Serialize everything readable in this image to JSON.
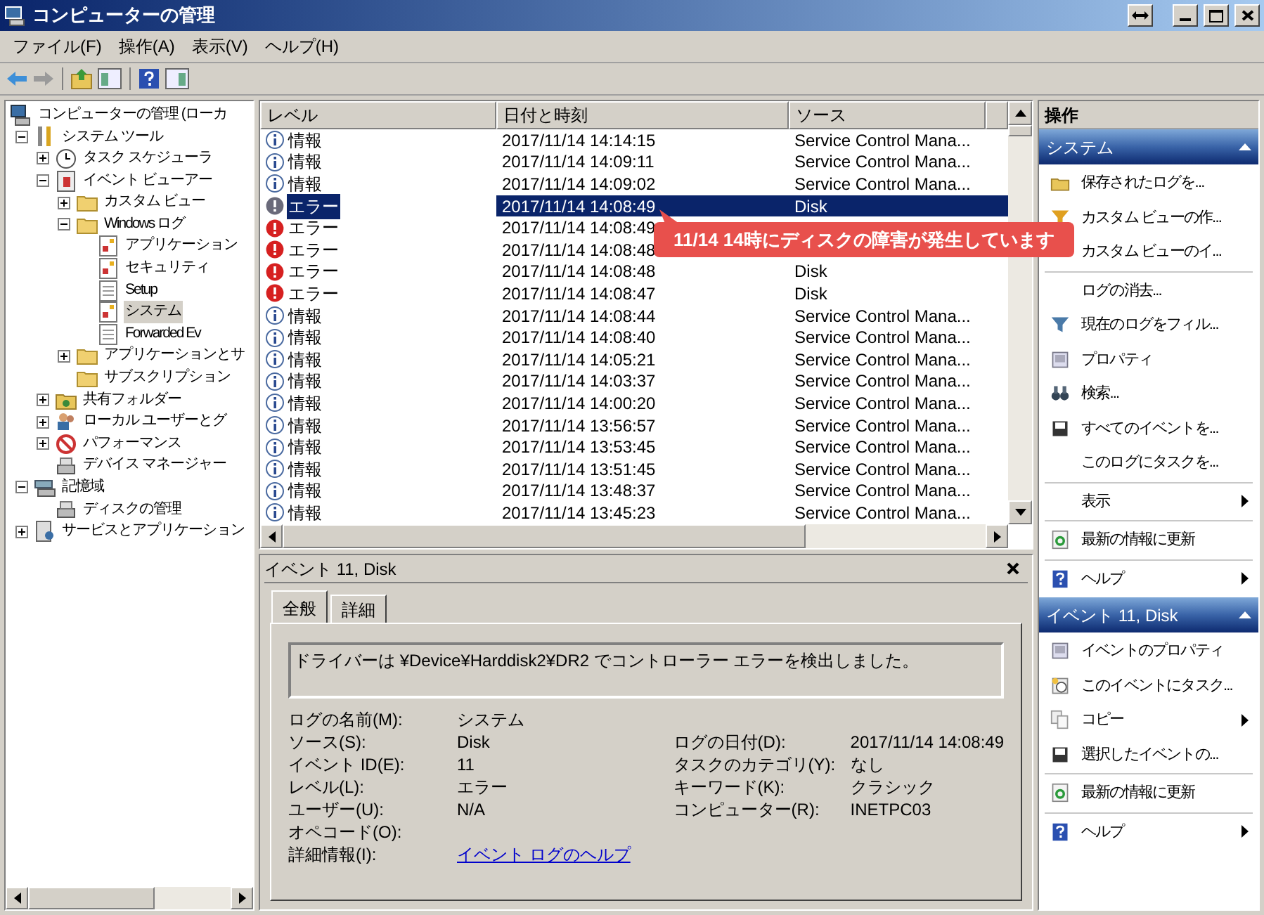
{
  "window": {
    "title": "コンピューターの管理"
  },
  "menu": [
    "ファイル(F)",
    "操作(A)",
    "表示(V)",
    "ヘルプ(H)"
  ],
  "tree": [
    {
      "label": "コンピューターの管理 (ローカ",
      "kind": "computer",
      "selected": false,
      "children": [
        {
          "label": "システム ツール",
          "kind": "tools",
          "expanded": true,
          "selected": false,
          "children": [
            {
              "label": "タスク スケジューラ",
              "kind": "clock",
              "expanded": false,
              "selected": false
            },
            {
              "label": "イベント ビューアー",
              "kind": "viewer",
              "expanded": true,
              "selected": false,
              "children": [
                {
                  "label": "カスタム ビュー",
                  "kind": "folder",
                  "expanded": false,
                  "selected": false
                },
                {
                  "label": "Windows ログ",
                  "kind": "folder",
                  "expanded": true,
                  "selected": false,
                  "children": [
                    {
                      "label": "アプリケーション",
                      "kind": "log",
                      "selected": false
                    },
                    {
                      "label": "セキュリティ",
                      "kind": "log",
                      "selected": false
                    },
                    {
                      "label": "Setup",
                      "kind": "doc",
                      "selected": false
                    },
                    {
                      "label": "システム",
                      "kind": "log",
                      "selected": true
                    },
                    {
                      "label": "Forwarded Ev",
                      "kind": "doc",
                      "selected": false
                    }
                  ]
                },
                {
                  "label": "アプリケーションとサ",
                  "kind": "folder",
                  "expanded": false,
                  "selected": false
                },
                {
                  "label": "サブスクリプション",
                  "kind": "folder",
                  "selected": false
                }
              ]
            },
            {
              "label": "共有フォルダー",
              "kind": "share",
              "expanded": false,
              "selected": false
            },
            {
              "label": "ローカル ユーザーとグ",
              "kind": "users",
              "expanded": false,
              "selected": false
            },
            {
              "label": "パフォーマンス",
              "kind": "perf",
              "expanded": false,
              "selected": false
            },
            {
              "label": "デバイス マネージャー",
              "kind": "device",
              "selected": false
            }
          ]
        },
        {
          "label": "記憶域",
          "kind": "storage",
          "expanded": true,
          "selected": false,
          "children": [
            {
              "label": "ディスクの管理",
              "kind": "device",
              "selected": false
            }
          ]
        },
        {
          "label": "サービスとアプリケーション",
          "kind": "services",
          "expanded": false,
          "selected": false
        }
      ]
    }
  ],
  "events": {
    "columns": [
      "レベル",
      "日付と時刻",
      "ソース"
    ],
    "rows": [
      {
        "kind": "info",
        "level": "情報",
        "datetime": "2017/11/14 14:14:15",
        "source": "Service Control Mana...",
        "selected": false
      },
      {
        "kind": "info",
        "level": "情報",
        "datetime": "2017/11/14 14:09:11",
        "source": "Service Control Mana...",
        "selected": false
      },
      {
        "kind": "info",
        "level": "情報",
        "datetime": "2017/11/14 14:09:02",
        "source": "Service Control Mana...",
        "selected": false
      },
      {
        "kind": "error",
        "level": "エラー",
        "datetime": "2017/11/14 14:08:49",
        "source": "Disk",
        "selected": true
      },
      {
        "kind": "error",
        "level": "エラー",
        "datetime": "2017/11/14 14:08:49",
        "selected": false
      },
      {
        "kind": "error",
        "level": "エラー",
        "datetime": "2017/11/14 14:08:48",
        "selected": false
      },
      {
        "kind": "error",
        "level": "エラー",
        "datetime": "2017/11/14 14:08:48",
        "source": "Disk",
        "selected": false
      },
      {
        "kind": "error",
        "level": "エラー",
        "datetime": "2017/11/14 14:08:47",
        "source": "Disk",
        "selected": false
      },
      {
        "kind": "info",
        "level": "情報",
        "datetime": "2017/11/14 14:08:44",
        "source": "Service Control Mana...",
        "selected": false
      },
      {
        "kind": "info",
        "level": "情報",
        "datetime": "2017/11/14 14:08:40",
        "source": "Service Control Mana...",
        "selected": false
      },
      {
        "kind": "info",
        "level": "情報",
        "datetime": "2017/11/14 14:05:21",
        "source": "Service Control Mana...",
        "selected": false
      },
      {
        "kind": "info",
        "level": "情報",
        "datetime": "2017/11/14 14:03:37",
        "source": "Service Control Mana...",
        "selected": false
      },
      {
        "kind": "info",
        "level": "情報",
        "datetime": "2017/11/14 14:00:20",
        "source": "Service Control Mana...",
        "selected": false
      },
      {
        "kind": "info",
        "level": "情報",
        "datetime": "2017/11/14 13:56:57",
        "source": "Service Control Mana...",
        "selected": false
      },
      {
        "kind": "info",
        "level": "情報",
        "datetime": "2017/11/14 13:53:45",
        "source": "Service Control Mana...",
        "selected": false
      },
      {
        "kind": "info",
        "level": "情報",
        "datetime": "2017/11/14 13:51:45",
        "source": "Service Control Mana...",
        "selected": false
      },
      {
        "kind": "info",
        "level": "情報",
        "datetime": "2017/11/14 13:48:37",
        "source": "Service Control Mana...",
        "selected": false
      },
      {
        "kind": "info",
        "level": "情報",
        "datetime": "2017/11/14 13:45:23",
        "source": "Service Control Mana...",
        "selected": false
      }
    ]
  },
  "callout": {
    "text": "11/14  14時にディスクの障害が発生しています"
  },
  "detail": {
    "title": "イベント 11, Disk",
    "tabs": [
      {
        "label": "全般",
        "selected": true
      },
      {
        "label": "詳細",
        "selected": false
      }
    ],
    "message": "ドライバーは ¥Device¥Harddisk2¥DR2 でコントローラー エラーを検出しました。",
    "fields_left": [
      {
        "label": "ログの名前(M):",
        "value": "システム"
      },
      {
        "label": "ソース(S):",
        "value": "Disk"
      },
      {
        "label": "イベント ID(E):",
        "value": "11"
      },
      {
        "label": "レベル(L):",
        "value": "エラー"
      },
      {
        "label": "ユーザー(U):",
        "value": "N/A"
      },
      {
        "label": "オペコード(O):"
      },
      {
        "label": "詳細情報(I):",
        "value": "イベント ログのヘルプ",
        "kind": "link"
      }
    ],
    "fields_right": [
      {
        "label": "ログの日付(D):",
        "value": "2017/11/14 14:08:49"
      },
      {
        "label": "タスクのカテゴリ(Y):",
        "value": "なし"
      },
      {
        "label": "キーワード(K):",
        "value": "クラシック"
      },
      {
        "label": "コンピューター(R):",
        "value": "INETPC03"
      }
    ]
  },
  "actions": {
    "title": "操作",
    "sections": [
      {
        "title": "システム",
        "groups": [
          [
            {
              "label": "保存されたログを...",
              "kind": "open",
              "submenu": false
            },
            {
              "label": "カスタム ビューの作...",
              "kind": "create-view",
              "submenu": false
            },
            {
              "label": "カスタム ビューのイ...",
              "kind": "plain",
              "submenu": false
            }
          ],
          [
            {
              "label": "ログの消去...",
              "kind": "plain",
              "submenu": false
            },
            {
              "label": "現在のログをフィル...",
              "kind": "filter",
              "submenu": false
            },
            {
              "label": "プロパティ",
              "kind": "properties",
              "submenu": false
            },
            {
              "label": "検索...",
              "kind": "find",
              "submenu": false
            },
            {
              "label": "すべてのイベントを...",
              "kind": "save",
              "submenu": false
            },
            {
              "label": "このログにタスクを...",
              "kind": "plain",
              "submenu": false
            }
          ],
          [
            {
              "label": "表示",
              "kind": "plain",
              "submenu": true
            }
          ],
          [
            {
              "label": "最新の情報に更新",
              "kind": "refresh",
              "submenu": false
            }
          ],
          [
            {
              "label": "ヘルプ",
              "kind": "help",
              "submenu": true
            }
          ]
        ]
      },
      {
        "title": "イベント 11, Disk",
        "groups": [
          [
            {
              "label": "イベントのプロパティ",
              "kind": "properties",
              "submenu": false
            },
            {
              "label": "このイベントにタスク...",
              "kind": "task",
              "submenu": false
            },
            {
              "label": "コピー",
              "kind": "copy",
              "submenu": true
            },
            {
              "label": "選択したイベントの...",
              "kind": "save",
              "submenu": false
            }
          ],
          [
            {
              "label": "最新の情報に更新",
              "kind": "refresh",
              "submenu": false
            }
          ],
          [
            {
              "label": "ヘルプ",
              "kind": "help",
              "submenu": true
            }
          ]
        ]
      }
    ]
  }
}
